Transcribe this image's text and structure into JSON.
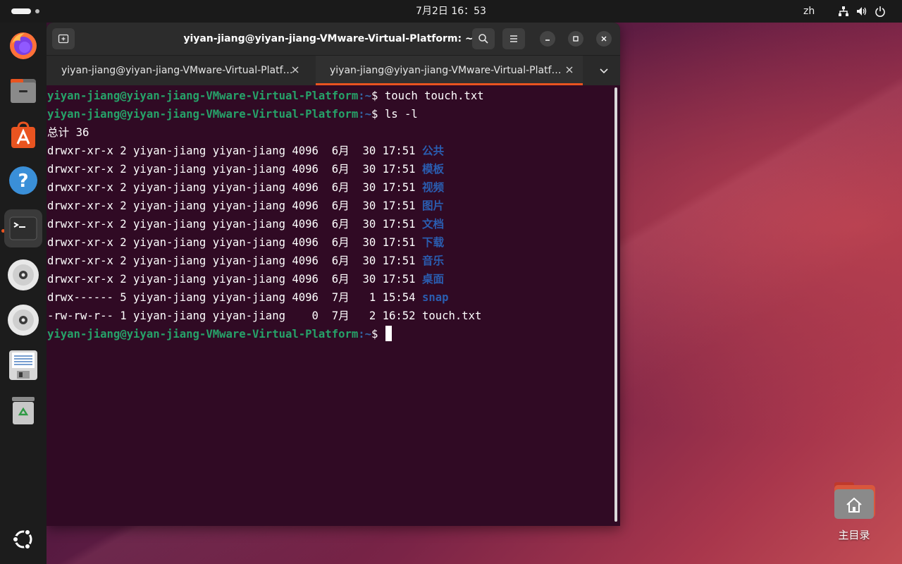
{
  "topbar": {
    "clock": "7月2日  16：53",
    "input_lang": "zh",
    "tray_icons": [
      "network-icon",
      "volume-icon",
      "power-icon"
    ]
  },
  "dock": {
    "items": [
      {
        "name": "firefox",
        "icon": "firefox-icon"
      },
      {
        "name": "files",
        "icon": "files-icon"
      },
      {
        "name": "app-center",
        "icon": "app-center-icon"
      },
      {
        "name": "help",
        "icon": "help-icon"
      },
      {
        "name": "terminal",
        "icon": "terminal-icon",
        "active": true,
        "running": true
      },
      {
        "name": "disc-1",
        "icon": "optical-disc-icon"
      },
      {
        "name": "disc-2",
        "icon": "optical-disc-icon"
      },
      {
        "name": "floppy",
        "icon": "floppy-drive-icon"
      },
      {
        "name": "trash",
        "icon": "trash-icon"
      },
      {
        "name": "show-apps",
        "icon": "ubuntu-logo-icon"
      }
    ]
  },
  "window": {
    "title": "yiyan-jiang@yiyan-jiang-VMware-Virtual-Platform: ~",
    "tabs": [
      {
        "label": "yiyan-jiang@yiyan-jiang-VMware-Virtual-Platf…",
        "active": false
      },
      {
        "label": "yiyan-jiang@yiyan-jiang-VMware-Virtual-Platf…",
        "active": true
      }
    ]
  },
  "terminal": {
    "prompt_user": "yiyan-jiang@yiyan-jiang-VMware-Virtual-Platform",
    "prompt_path": ":~",
    "prompt_symbol": "$ ",
    "commands": [
      "touch touch.txt",
      "ls -l"
    ],
    "total_line": "总计 36",
    "listing": [
      {
        "meta": "drwxr-xr-x 2 yiyan-jiang yiyan-jiang 4096  6月  30 17:51 ",
        "name": "公共",
        "is_dir": true
      },
      {
        "meta": "drwxr-xr-x 2 yiyan-jiang yiyan-jiang 4096  6月  30 17:51 ",
        "name": "模板",
        "is_dir": true
      },
      {
        "meta": "drwxr-xr-x 2 yiyan-jiang yiyan-jiang 4096  6月  30 17:51 ",
        "name": "视频",
        "is_dir": true
      },
      {
        "meta": "drwxr-xr-x 2 yiyan-jiang yiyan-jiang 4096  6月  30 17:51 ",
        "name": "图片",
        "is_dir": true
      },
      {
        "meta": "drwxr-xr-x 2 yiyan-jiang yiyan-jiang 4096  6月  30 17:51 ",
        "name": "文档",
        "is_dir": true
      },
      {
        "meta": "drwxr-xr-x 2 yiyan-jiang yiyan-jiang 4096  6月  30 17:51 ",
        "name": "下载",
        "is_dir": true
      },
      {
        "meta": "drwxr-xr-x 2 yiyan-jiang yiyan-jiang 4096  6月  30 17:51 ",
        "name": "音乐",
        "is_dir": true
      },
      {
        "meta": "drwxr-xr-x 2 yiyan-jiang yiyan-jiang 4096  6月  30 17:51 ",
        "name": "桌面",
        "is_dir": true
      },
      {
        "meta": "drwx------ 5 yiyan-jiang yiyan-jiang 4096  7月   1 15:54 ",
        "name": "snap",
        "is_dir": true
      },
      {
        "meta": "-rw-rw-r-- 1 yiyan-jiang yiyan-jiang    0  7月   2 16:52 ",
        "name": "touch.txt",
        "is_dir": false
      }
    ]
  },
  "desktop": {
    "home_label": "主目录"
  },
  "colors": {
    "terminal_bg": "#300a24",
    "prompt_user": "#26a269",
    "prompt_path": "#3465a4",
    "directory": "#2a5db0",
    "accent": "#e95420"
  }
}
